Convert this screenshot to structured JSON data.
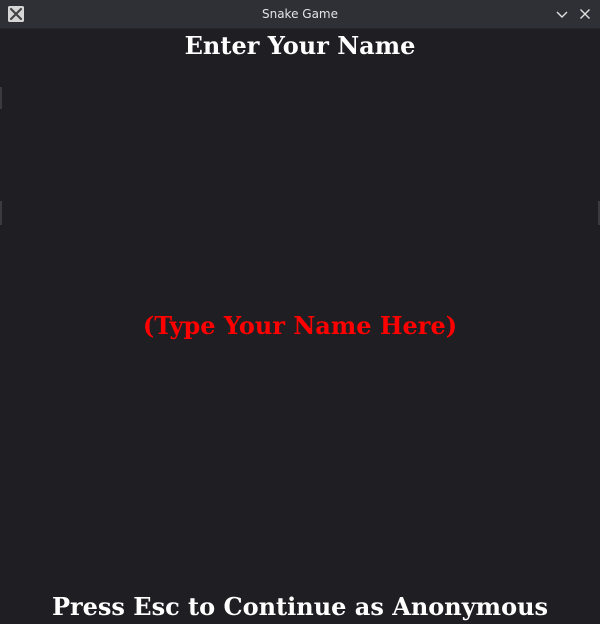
{
  "window": {
    "title": "Snake Game",
    "icons": {
      "app": "x-app-icon",
      "minimize": "chevron-down-icon",
      "close": "close-icon"
    }
  },
  "screen": {
    "heading": "Enter Your Name",
    "name_placeholder": "(Type Your Name Here)",
    "footer_hint": "Press Esc to Continue as Anonymous"
  },
  "colors": {
    "background": "#1f1e22",
    "titlebar": "#2e3036",
    "heading_text": "#ffffff",
    "placeholder_text": "#ff0000"
  }
}
